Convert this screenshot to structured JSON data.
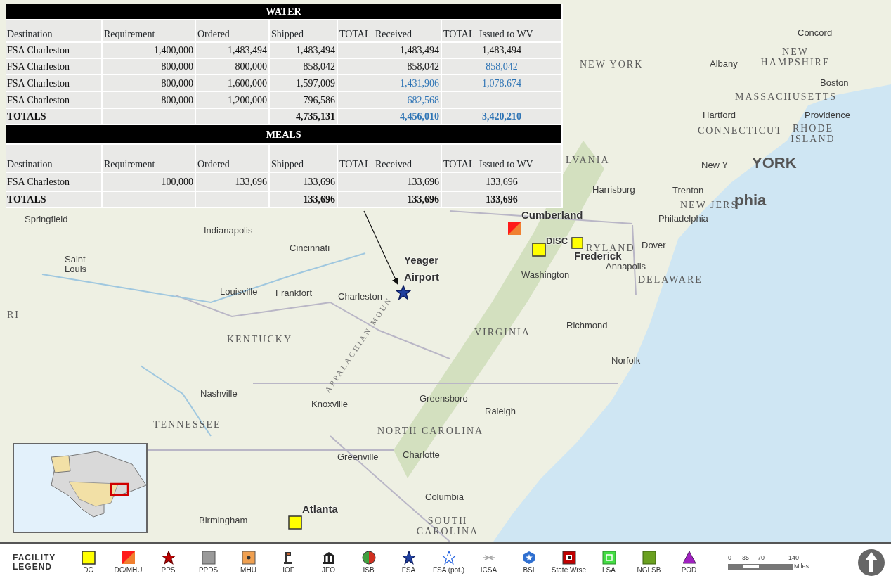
{
  "tables": [
    {
      "title": "WATER",
      "columns": [
        "Destination",
        "Requirement",
        "Ordered",
        "Shipped",
        "TOTAL  Received",
        "TOTAL  Issued to WV"
      ],
      "rows": [
        {
          "kind": "data",
          "cells": [
            {
              "text": "FSA Charleston",
              "blue": false
            },
            {
              "text": "1,400,000",
              "blue": false
            },
            {
              "text": "1,483,494",
              "blue": false
            },
            {
              "text": "1,483,494",
              "blue": false
            },
            {
              "text": "1,483,494",
              "blue": false
            },
            {
              "text": "1,483,494",
              "blue": false
            }
          ]
        },
        {
          "kind": "data",
          "cells": [
            {
              "text": "FSA Charleston",
              "blue": false
            },
            {
              "text": "800,000",
              "blue": false
            },
            {
              "text": "800,000",
              "blue": false
            },
            {
              "text": "858,042",
              "blue": false
            },
            {
              "text": "858,042",
              "blue": false
            },
            {
              "text": "858,042",
              "blue": true
            }
          ]
        },
        {
          "kind": "data",
          "cells": [
            {
              "text": "FSA Charleston",
              "blue": false
            },
            {
              "text": "800,000",
              "blue": false
            },
            {
              "text": "1,600,000",
              "blue": false
            },
            {
              "text": "1,597,009",
              "blue": false
            },
            {
              "text": "1,431,906",
              "blue": true
            },
            {
              "text": "1,078,674",
              "blue": true
            }
          ]
        },
        {
          "kind": "data",
          "cells": [
            {
              "text": "FSA Charleston",
              "blue": false
            },
            {
              "text": "800,000",
              "blue": false
            },
            {
              "text": "1,200,000",
              "blue": false
            },
            {
              "text": "796,586",
              "blue": false
            },
            {
              "text": "682,568",
              "blue": true
            },
            null
          ]
        },
        {
          "kind": "total",
          "cells": [
            {
              "text": "TOTALS",
              "blue": false
            },
            null,
            null,
            {
              "text": "4,735,131",
              "blue": false
            },
            {
              "text": "4,456,010",
              "blue": true
            },
            {
              "text": "3,420,210",
              "blue": true
            }
          ]
        }
      ]
    },
    {
      "title": "MEALS",
      "columns": [
        "Destination",
        "Requirement",
        "Ordered",
        "Shipped",
        "TOTAL  Received",
        "TOTAL  Issued to WV"
      ],
      "rows": [
        {
          "kind": "data",
          "cells": [
            {
              "text": "FSA Charleston",
              "blue": false
            },
            {
              "text": "100,000",
              "blue": false
            },
            {
              "text": "133,696",
              "blue": false
            },
            {
              "text": "133,696",
              "blue": false
            },
            {
              "text": "133,696",
              "blue": false
            },
            {
              "text": "133,696",
              "blue": false
            }
          ]
        },
        {
          "kind": "total",
          "cells": [
            {
              "text": "TOTALS",
              "blue": false
            },
            null,
            null,
            {
              "text": "133,696",
              "blue": false
            },
            {
              "text": "133,696",
              "blue": false
            },
            {
              "text": "133,696",
              "blue": false
            }
          ]
        }
      ]
    }
  ],
  "map": {
    "labels": [
      {
        "kind": "city",
        "text": "Concord"
      },
      {
        "kind": "state",
        "text": "NEW YORK"
      },
      {
        "kind": "city",
        "text": "Albany"
      },
      {
        "kind": "state",
        "text": "NEW HAMPSHIRE"
      },
      {
        "kind": "city",
        "text": "Boston"
      },
      {
        "kind": "state",
        "text": "MASSACHUSETTS"
      },
      {
        "kind": "city",
        "text": "Hartford"
      },
      {
        "kind": "city",
        "text": "Providence"
      },
      {
        "kind": "state",
        "text": "CONNECTICUT"
      },
      {
        "kind": "state",
        "text": "RHODE ISLAND"
      },
      {
        "kind": "state",
        "text": "LVANIA"
      },
      {
        "kind": "city",
        "text": "New Y"
      },
      {
        "kind": "big",
        "text": "YORK"
      },
      {
        "kind": "city",
        "text": "Harrisburg"
      },
      {
        "kind": "city",
        "text": "Trenton"
      },
      {
        "kind": "state",
        "text": "NEW JERS"
      },
      {
        "kind": "big",
        "text": "phia"
      },
      {
        "kind": "city",
        "text": "Philadelphia"
      },
      {
        "kind": "facility",
        "text": "Cumberland"
      },
      {
        "kind": "facility",
        "text": "DISC"
      },
      {
        "kind": "state",
        "text": "RYLAND"
      },
      {
        "kind": "city",
        "text": "Dover"
      },
      {
        "kind": "facility",
        "text": "Frederick"
      },
      {
        "kind": "city",
        "text": "Annapolis"
      },
      {
        "kind": "state",
        "text": "DELAWARE"
      },
      {
        "kind": "city",
        "text": "Washington"
      },
      {
        "kind": "facility",
        "text": "Yeager"
      },
      {
        "kind": "facility",
        "text": "Airport"
      },
      {
        "kind": "city",
        "text": "Springfield"
      },
      {
        "kind": "city",
        "text": "Indianapolis"
      },
      {
        "kind": "city",
        "text": "Cincinnati"
      },
      {
        "kind": "city",
        "text": "Saint Louis"
      },
      {
        "kind": "city",
        "text": "Louisville"
      },
      {
        "kind": "city",
        "text": "Frankfort"
      },
      {
        "kind": "city",
        "text": "Charleston"
      },
      {
        "kind": "state",
        "text": "KENTUCKY"
      },
      {
        "kind": "state",
        "text": "VIRGINIA"
      },
      {
        "kind": "city",
        "text": "Richmond"
      },
      {
        "kind": "city",
        "text": "Norfolk"
      },
      {
        "kind": "range",
        "text": "APPALACHIAN MOUN"
      },
      {
        "kind": "city",
        "text": "Nashville"
      },
      {
        "kind": "city",
        "text": "Knoxville"
      },
      {
        "kind": "city",
        "text": "Greensboro"
      },
      {
        "kind": "city",
        "text": "Raleigh"
      },
      {
        "kind": "state",
        "text": "TENNESSEE"
      },
      {
        "kind": "state",
        "text": "NORTH CAROLINA"
      },
      {
        "kind": "city",
        "text": "Greenville"
      },
      {
        "kind": "city",
        "text": "Charlotte"
      },
      {
        "kind": "city",
        "text": "Columbia"
      },
      {
        "kind": "city",
        "text": "Birmingham"
      },
      {
        "kind": "facility",
        "text": "Atlanta"
      },
      {
        "kind": "state",
        "text": "SOUTH CAROLINA"
      },
      {
        "kind": "state",
        "text": "RI"
      }
    ],
    "facilities": [
      {
        "kind": "dc-mhu"
      },
      {
        "kind": "dc"
      },
      {
        "kind": "dc"
      },
      {
        "kind": "fsa"
      },
      {
        "kind": "dc"
      }
    ]
  },
  "legend": {
    "title": "FACILITY LEGEND",
    "items": [
      {
        "kind": "dc",
        "label": "DC"
      },
      {
        "kind": "dc-mhu",
        "label": "DC/MHU"
      },
      {
        "kind": "pps",
        "label": "PPS"
      },
      {
        "kind": "ppds",
        "label": "PPDS"
      },
      {
        "kind": "mhu",
        "label": "MHU"
      },
      {
        "kind": "iof",
        "label": "IOF"
      },
      {
        "kind": "jfo",
        "label": "JFO"
      },
      {
        "kind": "isb",
        "label": "ISB"
      },
      {
        "kind": "fsa",
        "label": "FSA"
      },
      {
        "kind": "fsa-pot",
        "label": "FSA (pot.)"
      },
      {
        "kind": "icsa",
        "label": "ICSA"
      },
      {
        "kind": "bsi",
        "label": "BSI"
      },
      {
        "kind": "state-wrse",
        "label": "State Wrse"
      },
      {
        "kind": "lsa",
        "label": "LSA"
      },
      {
        "kind": "nglsb",
        "label": "NGLSB"
      },
      {
        "kind": "pod",
        "label": "POD"
      }
    ],
    "scale": {
      "ticks": [
        "0",
        "35",
        "70",
        "140"
      ],
      "unit": "Miles"
    }
  }
}
